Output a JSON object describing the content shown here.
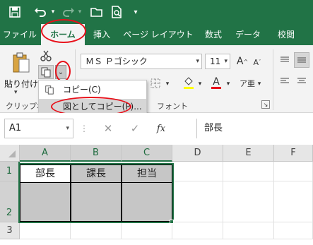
{
  "qat": {
    "save_icon": "save-icon",
    "undo_icon": "undo-icon",
    "redo_icon": "redo-icon",
    "open_icon": "open-folder-icon",
    "print_preview_icon": "print-preview-icon",
    "customize_icon": "customize-qat-icon"
  },
  "tabs": [
    {
      "label": "ファイル"
    },
    {
      "label": "ホーム"
    },
    {
      "label": "挿入"
    },
    {
      "label": "ページ レイアウト"
    },
    {
      "label": "数式"
    },
    {
      "label": "データ"
    },
    {
      "label": "校閲"
    }
  ],
  "ribbon": {
    "paste_label": "貼り付け",
    "clipboard_label": "クリップボ",
    "font_name": "ＭＳ Ｐゴシック",
    "font_size": "11",
    "font_group_label": "フォント"
  },
  "copy_menu": {
    "copy_label": "コピー(C)",
    "copy_as_picture_label": "図としてコピー(P)..."
  },
  "formula_bar": {
    "name_box": "A1",
    "fx_label": "fx",
    "formula": "部長"
  },
  "sheet": {
    "columns": [
      "A",
      "B",
      "C",
      "D",
      "E",
      "F"
    ],
    "rows": [
      "1",
      "2",
      "3"
    ],
    "cells": {
      "A1": "部長",
      "B1": "課長",
      "C1": "担当"
    }
  },
  "colors": {
    "excel_green": "#217346",
    "ribbon_bg": "#f3f3f3",
    "selection_fill": "#c6c6c6",
    "annotation_red": "#e8101a"
  }
}
